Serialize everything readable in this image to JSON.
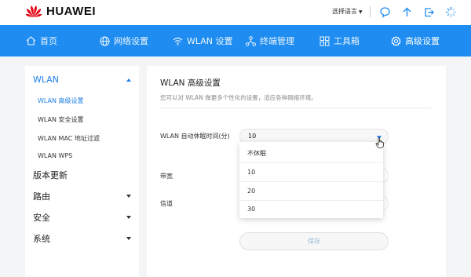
{
  "header": {
    "brand": "HUAWEI",
    "language_label": "选择语言",
    "icons": [
      "chat-bubble-icon",
      "arrow-up-icon",
      "logout-icon",
      "loading-spinner-icon"
    ]
  },
  "nav": {
    "items": [
      {
        "label": "首页",
        "icon": "home-icon"
      },
      {
        "label": "网络设置",
        "icon": "globe-icon"
      },
      {
        "label": "WLAN 设置",
        "icon": "wifi-icon"
      },
      {
        "label": "终端管理",
        "icon": "devices-icon"
      },
      {
        "label": "工具箱",
        "icon": "toolbox-icon"
      },
      {
        "label": "高级设置",
        "icon": "gear-icon",
        "active": true
      }
    ]
  },
  "sidebar": {
    "wlan_group": "WLAN",
    "wlan_items": [
      "WLAN 高级设置",
      "WLAN 安全设置",
      "WLAN MAC 地址过滤",
      "WLAN WPS"
    ],
    "version_update": "版本更新",
    "router": "路由",
    "security": "安全",
    "system": "系统"
  },
  "main": {
    "title": "WLAN 高级设置",
    "description": "您可以对 WLAN 做更多个性化的设置，适应各种网络环境。",
    "sleep_label": "WLAN 自动休眠时间(分)",
    "sleep_value": "10",
    "bandwidth_label": "带宽",
    "channel_label": "信道",
    "dropdown_options": [
      "不休眠",
      "10",
      "20",
      "30"
    ],
    "save_label": "保存"
  },
  "colors": {
    "nav_blue": "#1e8cf0",
    "active_blue": "#1e7fe6",
    "brand_red": "#e60012"
  }
}
